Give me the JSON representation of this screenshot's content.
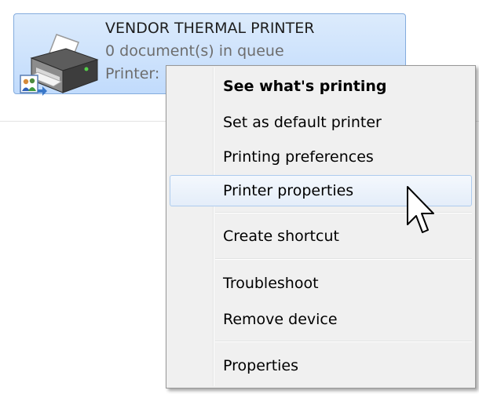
{
  "device": {
    "name": "VENDOR THERMAL PRINTER",
    "queue_status": "0 document(s) in queue",
    "status_prefix": "Printer:",
    "icon": "printer-icon",
    "badge_icon": "shared-users-icon"
  },
  "context_menu": {
    "items": [
      {
        "label": "See what's printing"
      },
      {
        "label": "Set as default printer"
      },
      {
        "label": "Printing preferences"
      },
      {
        "label": "Printer properties"
      },
      {
        "label": "Create shortcut"
      },
      {
        "label": "Troubleshoot"
      },
      {
        "label": "Remove device"
      },
      {
        "label": "Properties"
      }
    ],
    "default_item": "See what's printing",
    "highlighted_item": "Printer properties"
  },
  "cursor": {
    "icon": "arrow-cursor-icon"
  },
  "colors": {
    "tile_border": "#84acdd",
    "tile_fill": "#c1dbfc",
    "menu_bg": "#f0f0f0",
    "menu_border": "#979797",
    "hover_border": "#aeccee"
  }
}
